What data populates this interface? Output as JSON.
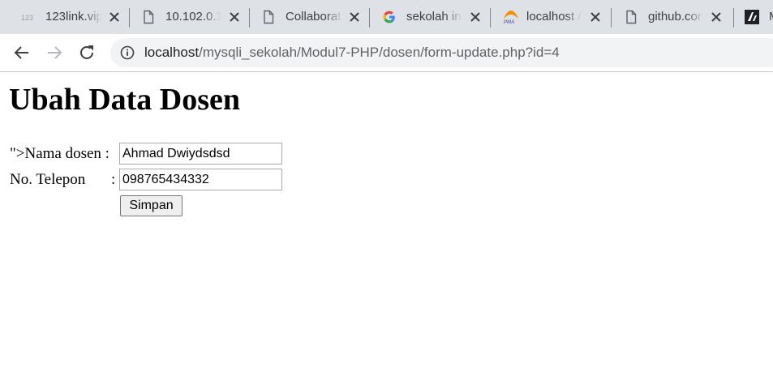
{
  "browser": {
    "tabs": [
      {
        "title": "123link.vip",
        "icon": "favicon-123link"
      },
      {
        "title": "10.102.0.1",
        "icon": "page-icon"
      },
      {
        "title": "Collaborat",
        "icon": "page-icon"
      },
      {
        "title": "sekolah in",
        "icon": "google-icon"
      },
      {
        "title": "localhost /",
        "icon": "phpmyadmin-icon"
      },
      {
        "title": "github.cor",
        "icon": "page-icon"
      },
      {
        "title": "M",
        "icon": "tab-favicon"
      }
    ],
    "address": {
      "host": "localhost",
      "path": "/mysqli_sekolah/Modul7-PHP/dosen/form-update.php?id=4"
    },
    "colors": {
      "tabbar": "#dee1e6",
      "google_blue": "#4285f4",
      "pma_orange": "#f29111"
    }
  },
  "page": {
    "title": "Ubah Data Dosen",
    "form": {
      "name_label": "\">Nama dosen :",
      "name_value": "Ahmad Dwiydsdsd",
      "phone_label": "No. Telepon",
      "phone_colon": ":",
      "phone_value": "098765434332",
      "submit_label": "Simpan"
    }
  }
}
